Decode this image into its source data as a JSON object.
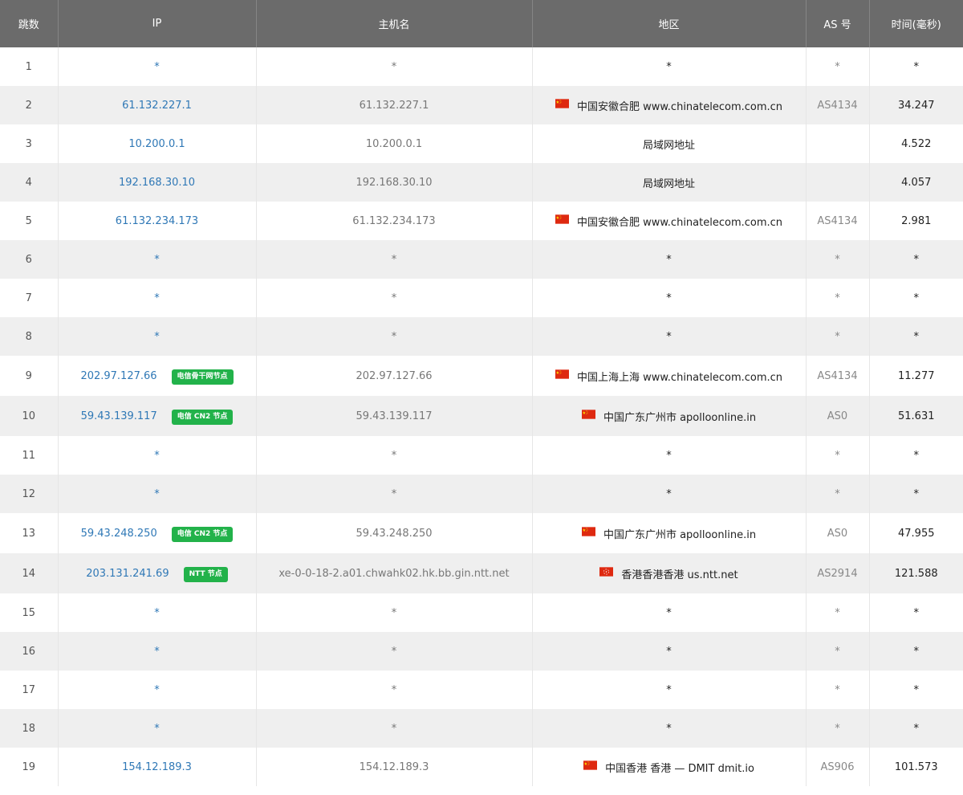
{
  "headers": {
    "hop": "跳数",
    "ip": "IP",
    "hostname": "主机名",
    "region": "地区",
    "as": "AS 号",
    "time": "时间(毫秒)"
  },
  "colors": {
    "header_bg": "#6b6b6b",
    "ip_link": "#2f78b6",
    "badge_bg": "#22b24a",
    "row_alt": "#efefef"
  },
  "rows": [
    {
      "hop": "1",
      "ip": "*",
      "host": "*",
      "flag": "",
      "region": "*",
      "as": "*",
      "time": "*",
      "badge": ""
    },
    {
      "hop": "2",
      "ip": "61.132.227.1",
      "host": "61.132.227.1",
      "flag": "cn",
      "region": "中国安徽合肥 www.chinatelecom.com.cn",
      "as": "AS4134",
      "time": "34.247",
      "badge": ""
    },
    {
      "hop": "3",
      "ip": "10.200.0.1",
      "host": "10.200.0.1",
      "flag": "",
      "region": "局域网地址",
      "as": "",
      "time": "4.522",
      "badge": ""
    },
    {
      "hop": "4",
      "ip": "192.168.30.10",
      "host": "192.168.30.10",
      "flag": "",
      "region": "局域网地址",
      "as": "",
      "time": "4.057",
      "badge": ""
    },
    {
      "hop": "5",
      "ip": "61.132.234.173",
      "host": "61.132.234.173",
      "flag": "cn",
      "region": "中国安徽合肥 www.chinatelecom.com.cn",
      "as": "AS4134",
      "time": "2.981",
      "badge": ""
    },
    {
      "hop": "6",
      "ip": "*",
      "host": "*",
      "flag": "",
      "region": "*",
      "as": "*",
      "time": "*",
      "badge": ""
    },
    {
      "hop": "7",
      "ip": "*",
      "host": "*",
      "flag": "",
      "region": "*",
      "as": "*",
      "time": "*",
      "badge": ""
    },
    {
      "hop": "8",
      "ip": "*",
      "host": "*",
      "flag": "",
      "region": "*",
      "as": "*",
      "time": "*",
      "badge": ""
    },
    {
      "hop": "9",
      "ip": "202.97.127.66",
      "host": "202.97.127.66",
      "flag": "cn",
      "region": "中国上海上海 www.chinatelecom.com.cn",
      "as": "AS4134",
      "time": "11.277",
      "badge": "电信骨干网节点"
    },
    {
      "hop": "10",
      "ip": "59.43.139.117",
      "host": "59.43.139.117",
      "flag": "cn",
      "region": "中国广东广州市 apolloonline.in",
      "as": "AS0",
      "time": "51.631",
      "badge": "电信 CN2 节点"
    },
    {
      "hop": "11",
      "ip": "*",
      "host": "*",
      "flag": "",
      "region": "*",
      "as": "*",
      "time": "*",
      "badge": ""
    },
    {
      "hop": "12",
      "ip": "*",
      "host": "*",
      "flag": "",
      "region": "*",
      "as": "*",
      "time": "*",
      "badge": ""
    },
    {
      "hop": "13",
      "ip": "59.43.248.250",
      "host": "59.43.248.250",
      "flag": "cn",
      "region": "中国广东广州市 apolloonline.in",
      "as": "AS0",
      "time": "47.955",
      "badge": "电信 CN2 节点"
    },
    {
      "hop": "14",
      "ip": "203.131.241.69",
      "host": "xe-0-0-18-2.a01.chwahk02.hk.bb.gin.ntt.net",
      "flag": "hk",
      "region": "香港香港香港 us.ntt.net",
      "as": "AS2914",
      "time": "121.588",
      "badge": "NTT 节点"
    },
    {
      "hop": "15",
      "ip": "*",
      "host": "*",
      "flag": "",
      "region": "*",
      "as": "*",
      "time": "*",
      "badge": ""
    },
    {
      "hop": "16",
      "ip": "*",
      "host": "*",
      "flag": "",
      "region": "*",
      "as": "*",
      "time": "*",
      "badge": ""
    },
    {
      "hop": "17",
      "ip": "*",
      "host": "*",
      "flag": "",
      "region": "*",
      "as": "*",
      "time": "*",
      "badge": ""
    },
    {
      "hop": "18",
      "ip": "*",
      "host": "*",
      "flag": "",
      "region": "*",
      "as": "*",
      "time": "*",
      "badge": ""
    },
    {
      "hop": "19",
      "ip": "154.12.189.3",
      "host": "154.12.189.3",
      "flag": "cn",
      "region": "中国香港 香港 — DMIT dmit.io",
      "as": "AS906",
      "time": "101.573",
      "badge": ""
    }
  ]
}
